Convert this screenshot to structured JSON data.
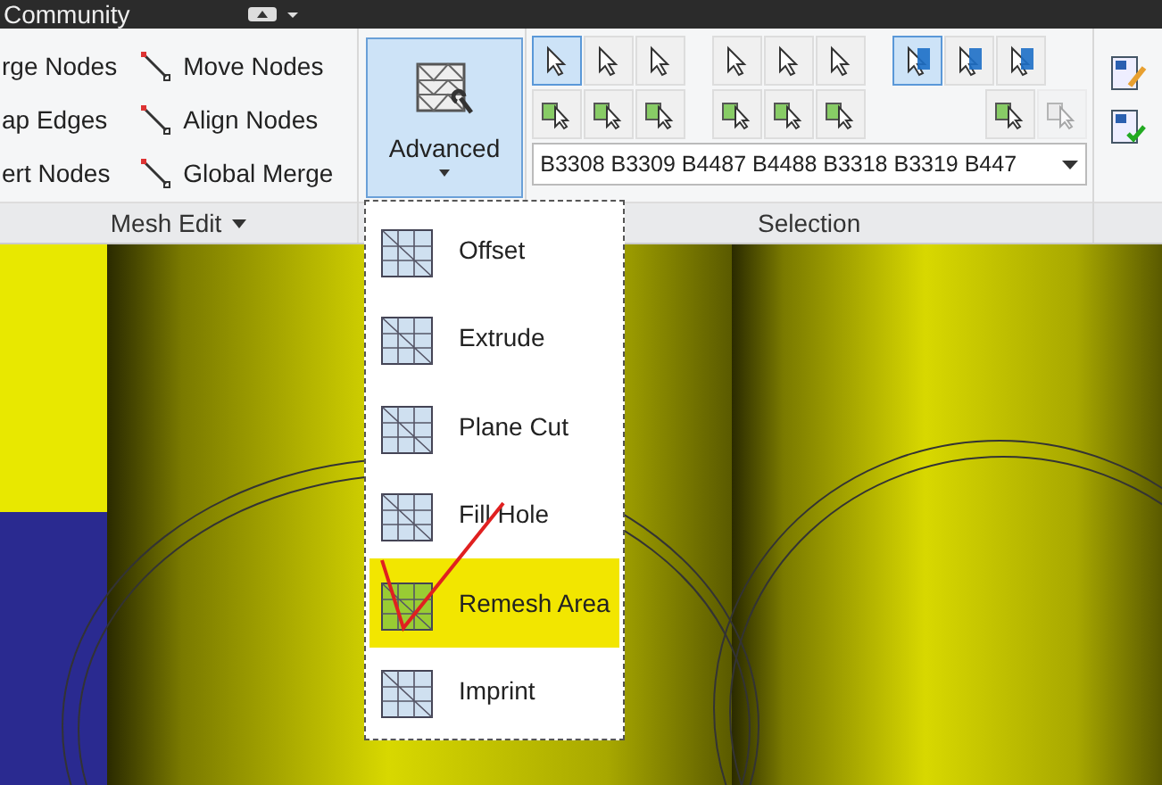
{
  "top_bar": {
    "title": "Community"
  },
  "mesh_edit": {
    "label": "Mesh Edit",
    "columns": [
      [
        "rge Nodes",
        "ap Edges",
        "ert Nodes"
      ],
      [
        "Move Nodes",
        "Align Nodes",
        "Global Merge"
      ]
    ]
  },
  "advanced": {
    "label": "Advanced",
    "selected": true
  },
  "selection": {
    "label": "Selection",
    "field_value": "B3308 B3309 B4487 B4488 B3318 B3319 B447",
    "row_1": [
      {
        "on": true
      },
      {
        "on": false
      },
      {
        "on": false
      },
      {
        "on": false
      },
      {
        "on": false
      },
      {
        "on": false
      },
      {
        "on": true
      },
      {
        "on": false
      },
      {
        "on": false
      }
    ],
    "row_2": [
      {
        "on": false
      },
      {
        "on": false
      },
      {
        "on": false
      },
      {
        "on": false
      },
      {
        "on": false
      },
      {
        "on": false
      },
      {
        "on": false,
        "disabled": false
      },
      {
        "on": false,
        "disabled": true
      }
    ]
  },
  "menu": [
    {
      "label": "Offset",
      "selected": false
    },
    {
      "label": "Extrude",
      "selected": false
    },
    {
      "label": "Plane Cut",
      "selected": false
    },
    {
      "label": "Fill Hole",
      "selected": false
    },
    {
      "label": "Remesh Area",
      "selected": true
    },
    {
      "label": "Imprint",
      "selected": false
    }
  ]
}
